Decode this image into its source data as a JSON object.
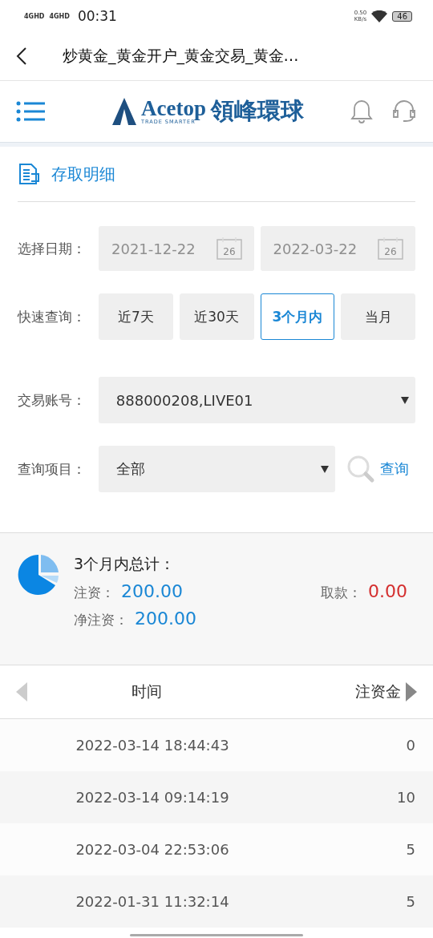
{
  "status_bar": {
    "networks": [
      "4GHD",
      "4GHD"
    ],
    "time": "00:31",
    "speed": "0.50",
    "speed_unit": "KB/s",
    "battery": "46"
  },
  "title_bar": {
    "title": "炒黄金_黄金开户_黄金交易_黄金…"
  },
  "header": {
    "brand": "Acetop",
    "tagline": "TRADE SMARTER",
    "brand_cn": "領峰環球"
  },
  "section": {
    "title": "存取明细"
  },
  "date_filter": {
    "label": "选择日期：",
    "fields": [
      {
        "value": "2021-12-22",
        "calendar_day": "26"
      },
      {
        "value": "2022-03-22",
        "calendar_day": "26"
      }
    ]
  },
  "quick_query": {
    "label": "快速查询：",
    "options": [
      {
        "label": "近7天",
        "selected": false
      },
      {
        "label": "近30天",
        "selected": false
      },
      {
        "label": "3个月内",
        "selected": true
      },
      {
        "label": "当月",
        "selected": false
      }
    ]
  },
  "account": {
    "label": "交易账号：",
    "value": "888000208,LIVE01"
  },
  "query_item": {
    "label": "查询项目：",
    "value": "全部",
    "button": "查询"
  },
  "summary": {
    "title": "3个月内总计：",
    "deposit_label": "注资：",
    "deposit": "200.00",
    "withdraw_label": "取款：",
    "withdraw": "0.00",
    "net_label": "净注资：",
    "net": "200.00"
  },
  "table": {
    "columns": [
      "时间",
      "注资金"
    ],
    "rows": [
      {
        "time": "2022-03-14 18:44:43",
        "amount": "0"
      },
      {
        "time": "2022-03-14 09:14:19",
        "amount": "10"
      },
      {
        "time": "2022-03-04 22:53:06",
        "amount": "5"
      },
      {
        "time": "2022-01-31 11:32:14",
        "amount": "5"
      }
    ]
  }
}
